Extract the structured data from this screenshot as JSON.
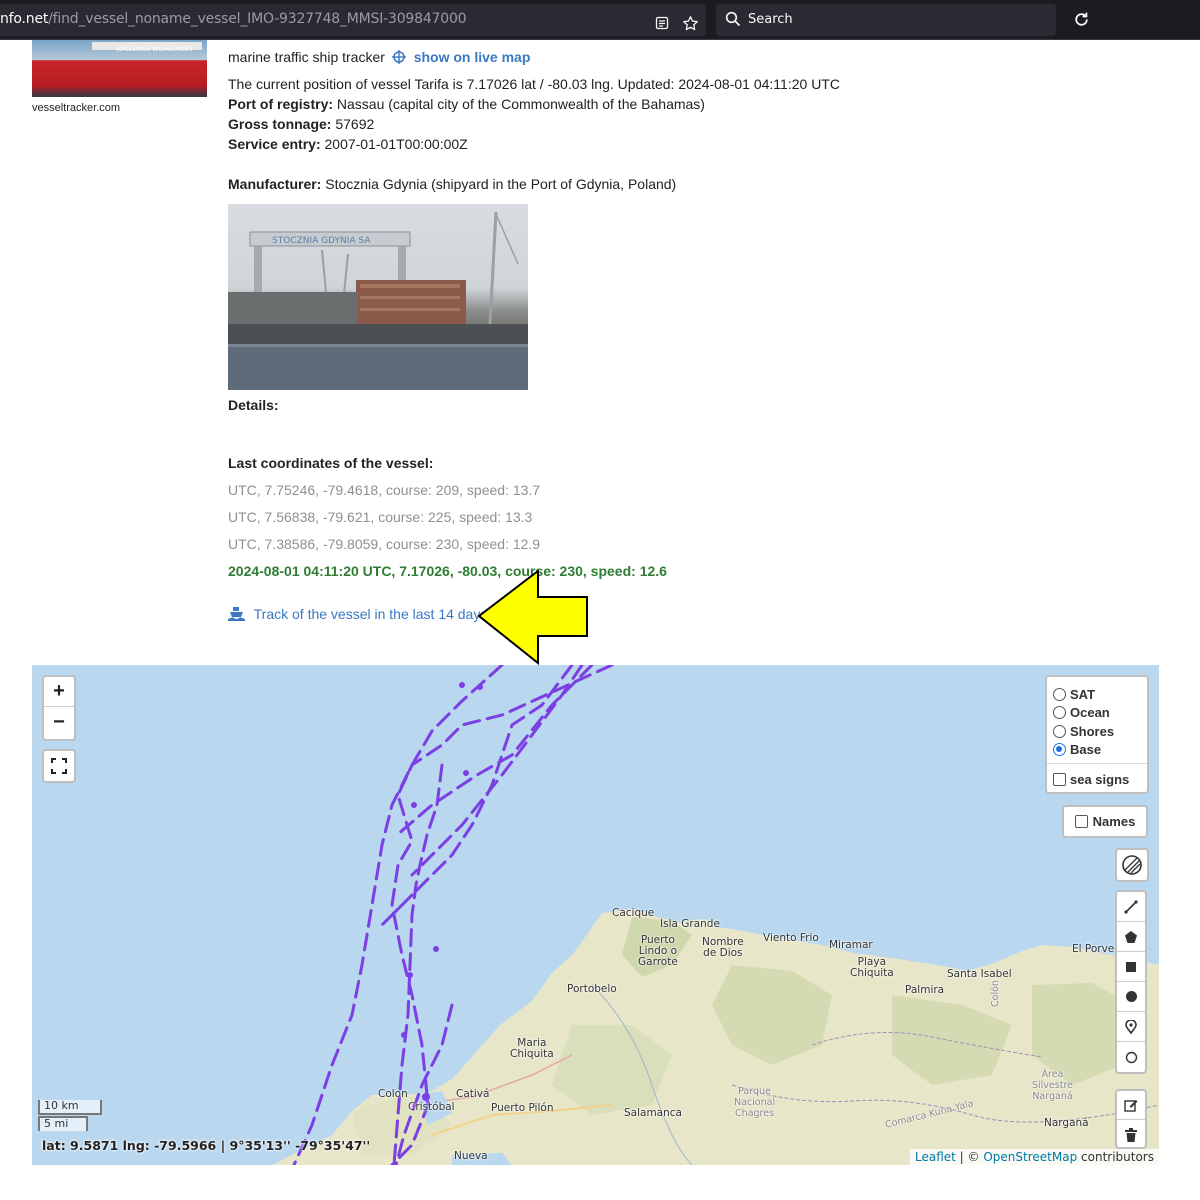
{
  "browser": {
    "url_host": "nfo.net",
    "url_path": "/find_vessel_noname_vessel_IMO-9327748_MMSI-309847000",
    "search_placeholder": "Search"
  },
  "photo": {
    "caption": "vesseltracker.com",
    "ship_label": "WALLENIUS WILHELMSEN"
  },
  "vessel": {
    "tracker_text": "marine traffic ship tracker",
    "live_map_link": "show on live map",
    "position_text": "The current position of vessel Tarifa is 7.17026 lat / -80.03 lng. Updated: 2024-08-01 04:11:20 UTC",
    "port_label": "Port of registry:",
    "port_value": "Nassau (capital city of the Commonwealth of the Bahamas)",
    "tonnage_label": "Gross tonnage:",
    "tonnage_value": "57692",
    "service_label": "Service entry:",
    "service_value": "2007-01-01T00:00:00Z",
    "manufacturer_label": "Manufacturer:",
    "manufacturer_value": "Stocznia Gdynia (shipyard in the Port of Gdynia, Poland)",
    "shipyard_sign": "STOCZNIA GDYNIA SA",
    "details_label": "Details:",
    "last_coords_label": "Last coordinates of the vessel:",
    "coords": [
      "UTC, 7.75246, -79.4618, course: 209, speed: 13.7",
      "UTC, 7.56838, -79.621, course: 225, speed: 13.3",
      "UTC, 7.38586, -79.8059, course: 230, speed: 12.9"
    ],
    "latest_coord": "2024-08-01 04:11:20 UTC, 7.17026, -80.03, course: 230, speed: 12.6",
    "track_link": "Track of the vessel in the last 14 days"
  },
  "map": {
    "zoom_in": "+",
    "zoom_out": "−",
    "layers": [
      {
        "label": "SAT",
        "selected": false
      },
      {
        "label": "Ocean",
        "selected": false
      },
      {
        "label": "Shores",
        "selected": false
      },
      {
        "label": "Base",
        "selected": true
      }
    ],
    "sea_signs": "sea signs",
    "names": "Names",
    "scale_km": "10 km",
    "scale_mi": "5 mi",
    "coords_readout": "lat: 9.5871 lng: -79.5966 | 9°35'13'' -79°35'47''",
    "attribution_leaflet": "Leaflet",
    "attribution_sep": " | © ",
    "attribution_osm": "OpenStreetMap",
    "attribution_tail": " contributors",
    "places": {
      "cacique": "Cacique",
      "isla_grande": "Isla Grande",
      "puerto_lindo": "Puerto\nLindo o\nGarrote",
      "nombre_de_dios": "Nombre\nde Dios",
      "viento_frio": "Viento Frio",
      "miramar": "Miramar",
      "el_porve": "El Porve",
      "playa_chiquita": "Playa\nChiquita",
      "santa_isabel": "Santa Isabel",
      "palmira": "Palmira",
      "portobelo": "Portobelo",
      "maria_chiquita": "Maria\nChiquita",
      "colon": "Colon",
      "cristobal": "Cristóbal",
      "cativa": "Cativá",
      "puerto_pilon": "Puerto Pilón",
      "salamanca": "Salamanca",
      "parque": "Parque\nNacional\nChagres",
      "area_silvestre": "Área\nSilvestre\nNarganá",
      "comarca": "Comarca Kuna Yala",
      "nargana": "Narganá",
      "nueva": "Nueva",
      "colon_river": "Colón"
    },
    "track_color": "#7b3fe4"
  },
  "colors": {
    "arrow": "#ffff00",
    "link": "#3a78c2",
    "latest": "#2e7d32",
    "land": "#e6e5c8",
    "sea": "#b9d7ef"
  }
}
